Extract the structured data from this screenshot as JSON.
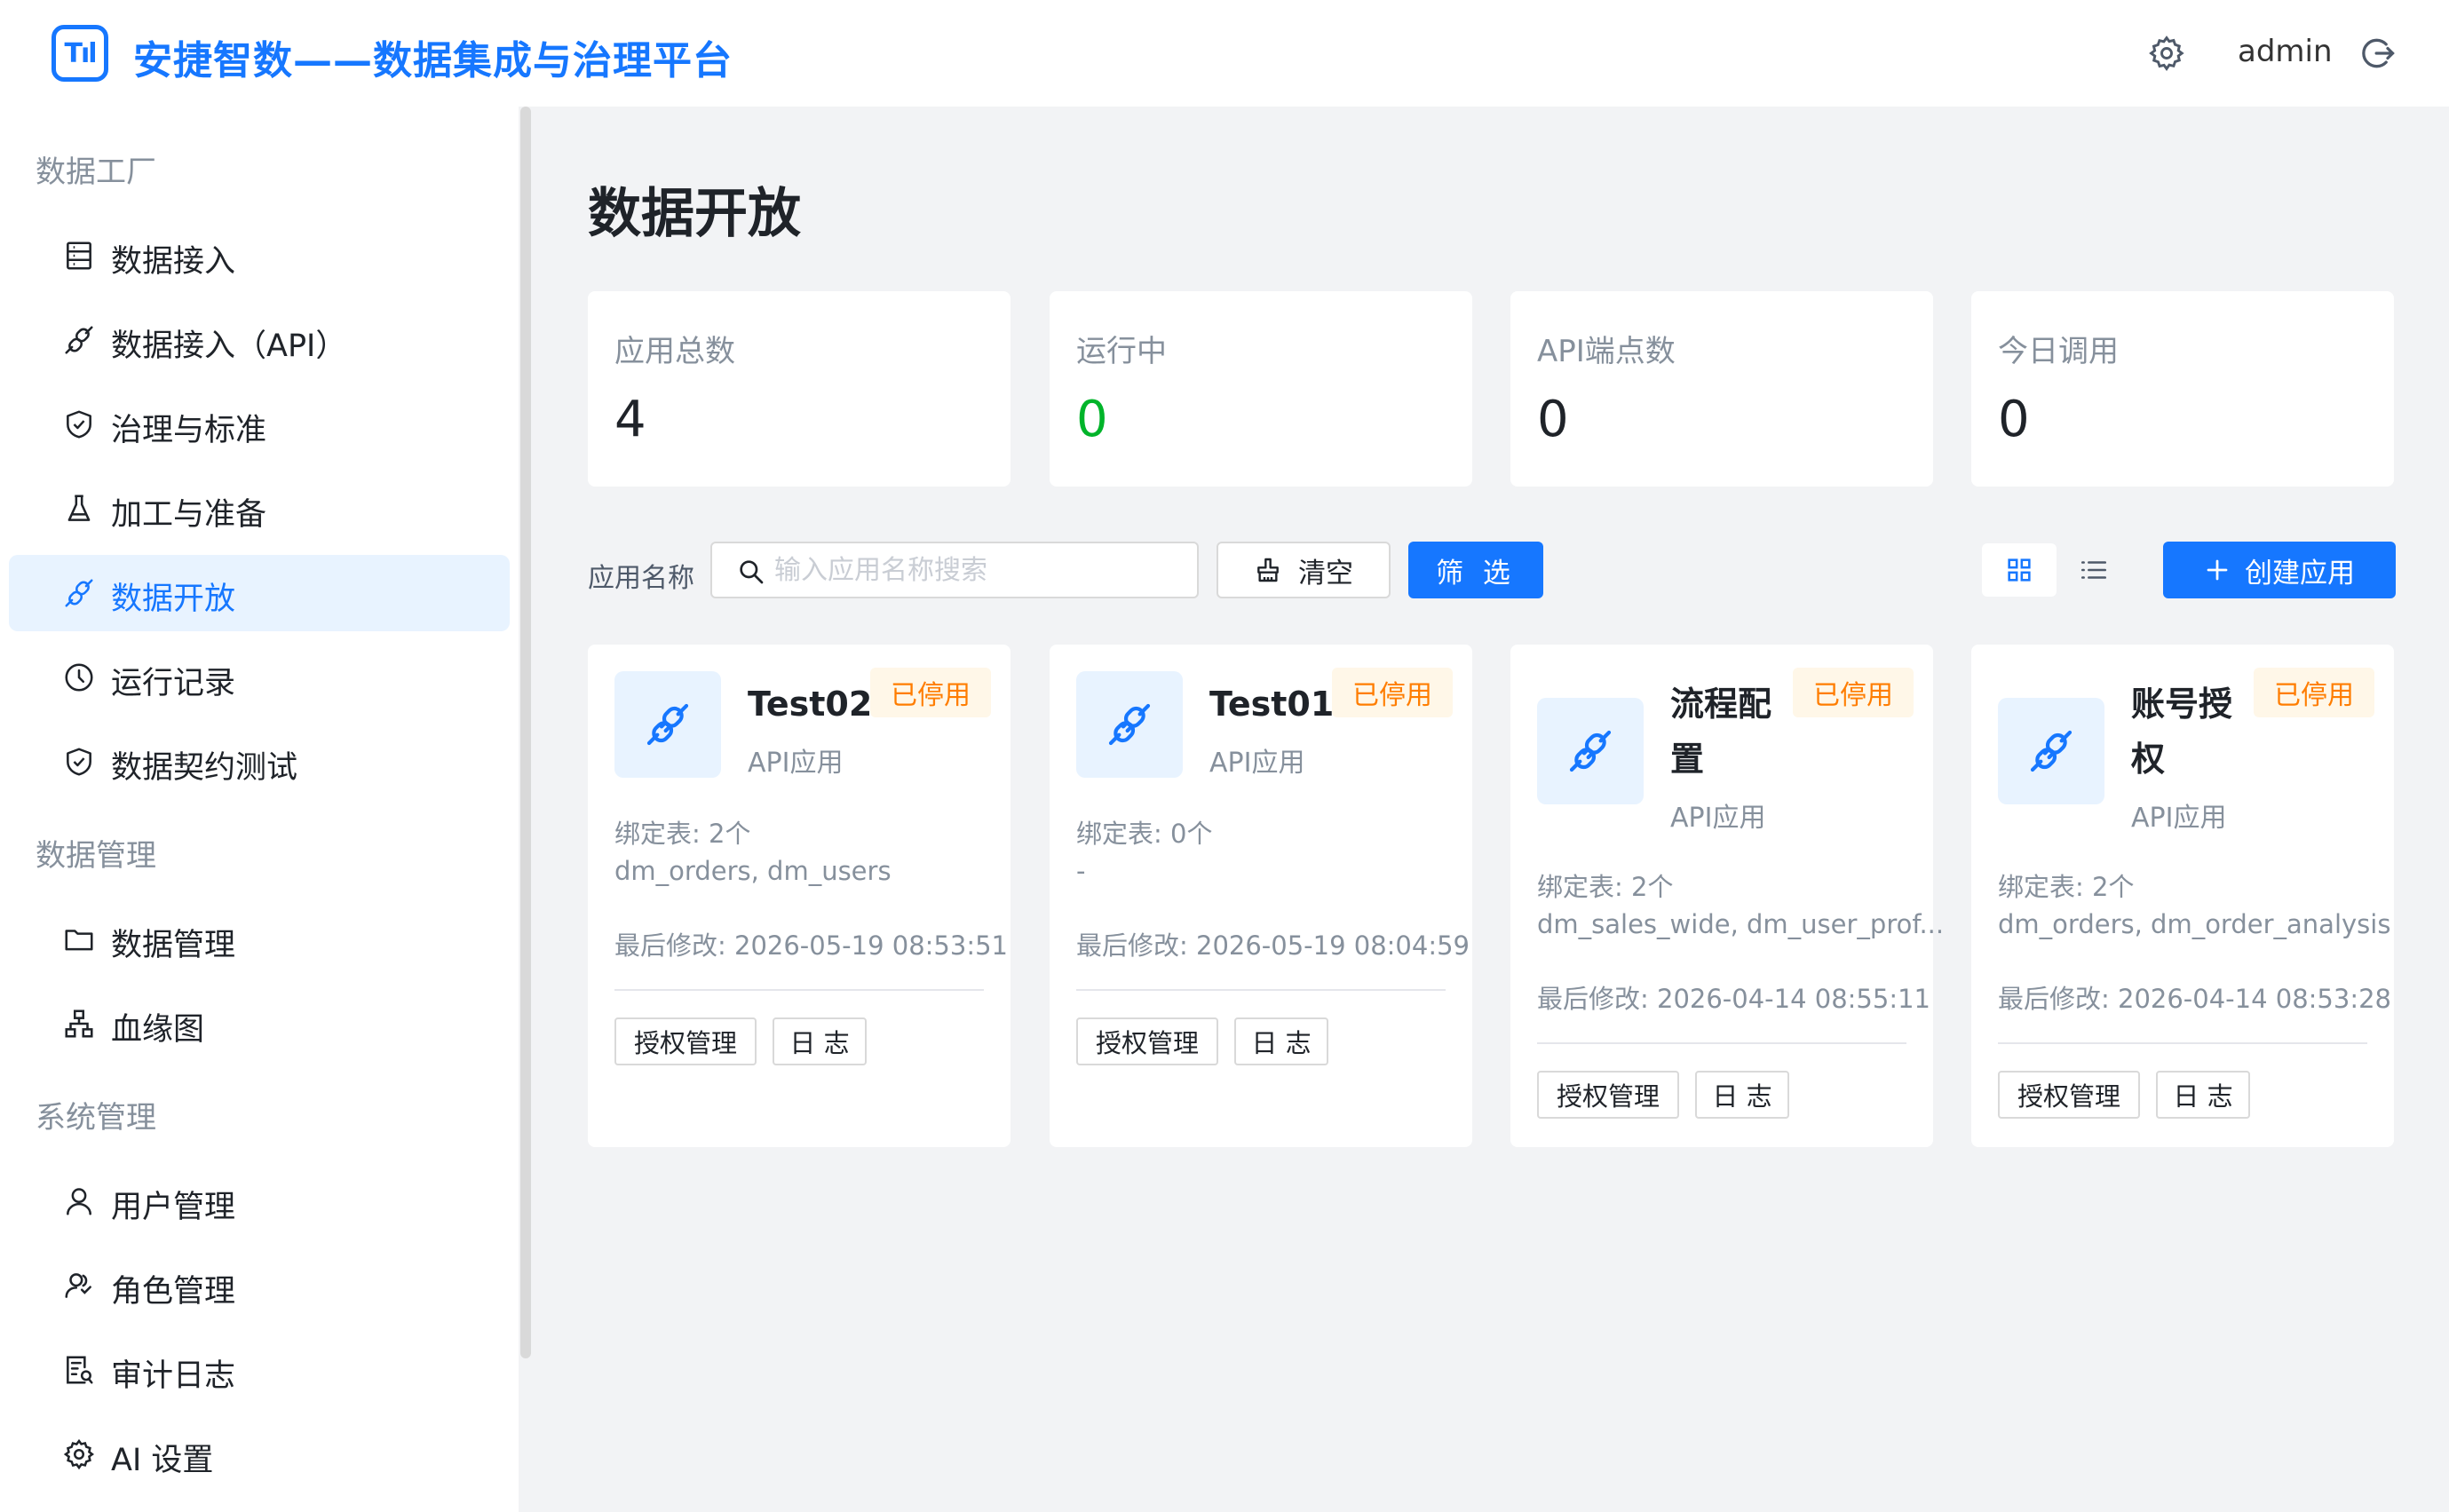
{
  "header": {
    "logo_text": "Tıl",
    "title": "安捷智数——数据集成与治理平台",
    "username": "admin",
    "settings_icon": "gear-icon",
    "logout_icon": "logout-icon"
  },
  "sidebar": {
    "sections": [
      {
        "label": "数据工厂",
        "items": [
          {
            "label": "数据接入",
            "icon": "database-icon"
          },
          {
            "label": "数据接入（API）",
            "icon": "link-icon"
          },
          {
            "label": "治理与标准",
            "icon": "shield-check-icon"
          },
          {
            "label": "加工与准备",
            "icon": "flask-icon"
          },
          {
            "label": "数据开放",
            "icon": "link-icon",
            "active": true
          },
          {
            "label": "运行记录",
            "icon": "clock-icon"
          },
          {
            "label": "数据契约测试",
            "icon": "shield-check-icon"
          }
        ]
      },
      {
        "label": "数据管理",
        "items": [
          {
            "label": "数据管理",
            "icon": "folder-icon"
          },
          {
            "label": "血缘图",
            "icon": "lineage-icon"
          }
        ]
      },
      {
        "label": "系统管理",
        "items": [
          {
            "label": "用户管理",
            "icon": "user-icon"
          },
          {
            "label": "角色管理",
            "icon": "users-icon"
          },
          {
            "label": "审计日志",
            "icon": "audit-icon"
          },
          {
            "label": "AI 设置",
            "icon": "gear-icon"
          }
        ]
      }
    ]
  },
  "main": {
    "page_title": "数据开放",
    "stats": [
      {
        "label": "应用总数",
        "value": "4",
        "color": "#1f2329"
      },
      {
        "label": "运行中",
        "value": "0",
        "color": "#00b42a"
      },
      {
        "label": "API端点数",
        "value": "0",
        "color": "#1f2329"
      },
      {
        "label": "今日调用",
        "value": "0",
        "color": "#1f2329"
      }
    ],
    "filter": {
      "label": "应用名称",
      "placeholder": "输入应用名称搜索",
      "value": "",
      "clear_label": "清空",
      "filter_label": "筛 选",
      "create_label": "创建应用"
    },
    "apps": [
      {
        "name": "Test02",
        "name_lines": [
          "Test02"
        ],
        "type": "API应用",
        "status": "已停用",
        "bind": "绑定表: 2个",
        "tables": "dm_orders, dm_users",
        "modified": "最后修改: 2026-05-19 08:53:51",
        "auth_label": "授权管理",
        "log_label": "日 志"
      },
      {
        "name": "Test01",
        "name_lines": [
          "Test01"
        ],
        "type": "API应用",
        "status": "已停用",
        "bind": "绑定表: 0个",
        "tables": "-",
        "modified": "最后修改: 2026-05-19 08:04:59",
        "auth_label": "授权管理",
        "log_label": "日 志"
      },
      {
        "name": "流程配置",
        "name_lines": [
          "流程配",
          "置"
        ],
        "type": "API应用",
        "status": "已停用",
        "bind": "绑定表: 2个",
        "tables": "dm_sales_wide, dm_user_prof...",
        "modified": "最后修改: 2026-04-14 08:55:11",
        "auth_label": "授权管理",
        "log_label": "日 志"
      },
      {
        "name": "账号授权",
        "name_lines": [
          "账号授",
          "权"
        ],
        "type": "API应用",
        "status": "已停用",
        "bind": "绑定表: 2个",
        "tables": "dm_orders, dm_order_analysis",
        "modified": "最后修改: 2026-04-14 08:53:28",
        "auth_label": "授权管理",
        "log_label": "日 志"
      }
    ]
  }
}
